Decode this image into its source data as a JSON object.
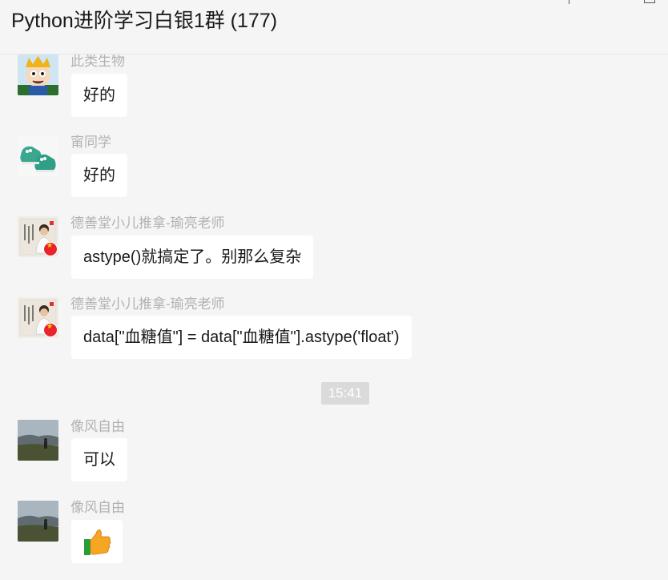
{
  "window": {
    "title": "Python进阶学习白银1群 (177)"
  },
  "messages": [
    {
      "sender": "此类生物",
      "text": "好的",
      "avatar": "cartoon-king-avatar"
    },
    {
      "sender": "甯同学",
      "text": "好的",
      "avatar": "green-shoes-avatar"
    },
    {
      "sender": "德善堂小儿推拿-瑜亮老师",
      "text": "astype()就搞定了。别那么复杂",
      "avatar": "teacher-photo-avatar"
    },
    {
      "sender": "德善堂小儿推拿-瑜亮老师",
      "text": "data[\"血糖值\"] = data[\"血糖值\"].astype('float')",
      "avatar": "teacher-photo-avatar"
    },
    {
      "sender": "像风自由",
      "text": "可以",
      "avatar": "landscape-avatar"
    },
    {
      "sender": "像风自由",
      "text": "👍",
      "avatar": "landscape-avatar"
    }
  ],
  "timestamp": "15:41",
  "colors": {
    "background": "#f5f5f5",
    "bubble": "#ffffff",
    "sender_name": "#b2b2b2",
    "time_badge": "#dadada"
  }
}
